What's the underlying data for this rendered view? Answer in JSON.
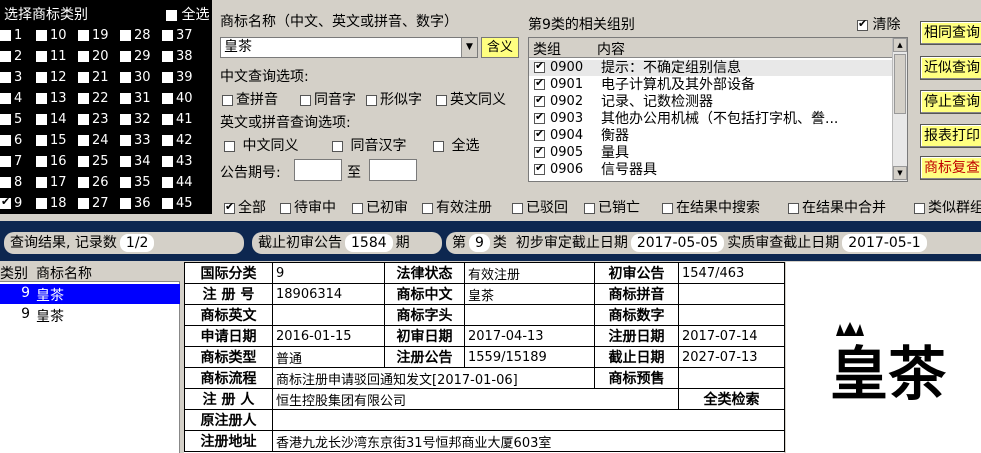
{
  "category_panel": {
    "title": "选择商标类别",
    "select_all_label": "全选",
    "checked": [
      "9"
    ],
    "columns": [
      [
        "1",
        "2",
        "3",
        "4",
        "5",
        "6",
        "7",
        "8",
        "9"
      ],
      [
        "10",
        "11",
        "12",
        "13",
        "14",
        "15",
        "16",
        "17",
        "18"
      ],
      [
        "19",
        "20",
        "21",
        "22",
        "23",
        "24",
        "25",
        "26",
        "27"
      ],
      [
        "28",
        "29",
        "30",
        "31",
        "32",
        "33",
        "34",
        "35",
        "36"
      ],
      [
        "37",
        "38",
        "39",
        "40",
        "41",
        "42",
        "43",
        "44",
        "45"
      ]
    ]
  },
  "query": {
    "name_label": "商标名称（中文、英文或拼音、数字）",
    "name_value": "皇茶",
    "meaning_button": "含义",
    "cn_options_label": "中文查询选项:",
    "cn_options": [
      "查拼音",
      "同音字",
      "形似字",
      "英文同义"
    ],
    "en_options_label": "英文或拼音查询选项:",
    "en_options": [
      "中文同义",
      "同音汉字",
      "全选"
    ],
    "issue_label": "公告期号:",
    "issue_to": "至"
  },
  "groups": {
    "title": "第9类的相关组别",
    "clear_label": "清除",
    "col_group": "类组",
    "col_content": "内容",
    "rows": [
      {
        "code": "0900",
        "desc": "提示：不确定组别信息"
      },
      {
        "code": "0901",
        "desc": "电子计算机及其外部设备"
      },
      {
        "code": "0902",
        "desc": "记录、记数检测器"
      },
      {
        "code": "0903",
        "desc": "其他办公用机械（不包括打字机、誊..."
      },
      {
        "code": "0904",
        "desc": "衡器"
      },
      {
        "code": "0905",
        "desc": "量具"
      },
      {
        "code": "0906",
        "desc": "信号器具"
      }
    ]
  },
  "actions": {
    "same_search": "相同查询",
    "similar_search": "近似查询",
    "stop_search": "停止查询",
    "print_report": "报表打印",
    "trademark_review": "商标复查"
  },
  "filters": [
    "全部",
    "待审中",
    "已初审",
    "有效注册",
    "已驳回",
    "已销亡",
    "在结果中搜索",
    "在结果中合并",
    "类似群组"
  ],
  "status": {
    "result_label": "查询结果, 记录数",
    "result_count": "1/2",
    "deadline_label": "截止初审公告",
    "deadline_value": "1584",
    "deadline_unit": "期",
    "class_prefix": "第",
    "class_value": "9",
    "class_suffix": "类",
    "prelim_label": "初步审定截止日期",
    "prelim_value": "2017-05-05",
    "exam_label": "实质审查截止日期",
    "exam_value": "2017-05-1"
  },
  "results": {
    "col_class": "类别",
    "col_name": "商标名称",
    "rows": [
      {
        "class": "9",
        "name": "皇茶"
      },
      {
        "class": "9",
        "name": "皇茶"
      }
    ]
  },
  "detail": {
    "intl_class_label": "国际分类",
    "intl_class": "9",
    "legal_status_label": "法律状态",
    "legal_status": "有效注册",
    "prelim_notice_label": "初审公告",
    "prelim_notice": "1547/463",
    "reg_no_label": "注 册 号",
    "reg_no": "18906314",
    "cn_name_label": "商标中文",
    "cn_name": "皇茶",
    "pinyin_label": "商标拼音",
    "pinyin": "",
    "en_name_label": "商标英文",
    "en_name": "",
    "initials_label": "商标字头",
    "initials": "",
    "digits_label": "商标数字",
    "digits": "",
    "apply_date_label": "申请日期",
    "apply_date": "2016-01-15",
    "prelim_date_label": "初审日期",
    "prelim_date": "2017-04-13",
    "reg_date_label": "注册日期",
    "reg_date": "2017-07-14",
    "type_label": "商标类型",
    "type": "普通",
    "reg_notice_label": "注册公告",
    "reg_notice": "1559/15189",
    "expiry_label": "截止日期",
    "expiry": "2027-07-13",
    "flow_label": "商标流程",
    "flow": "商标注册申请驳回通知发文[2017-01-06]",
    "presale_label": "商标预售",
    "presale": "",
    "registrant_label": "注 册 人",
    "registrant": "恒生控股集团有限公司",
    "full_search_label": "全类检索",
    "orig_registrant_label": "原注册人",
    "orig_registrant": "",
    "address_label": "注册地址",
    "address": "香港九龙长沙湾东京街31号恒邦商业大厦603室"
  },
  "logo": {
    "text": "皇茶"
  }
}
